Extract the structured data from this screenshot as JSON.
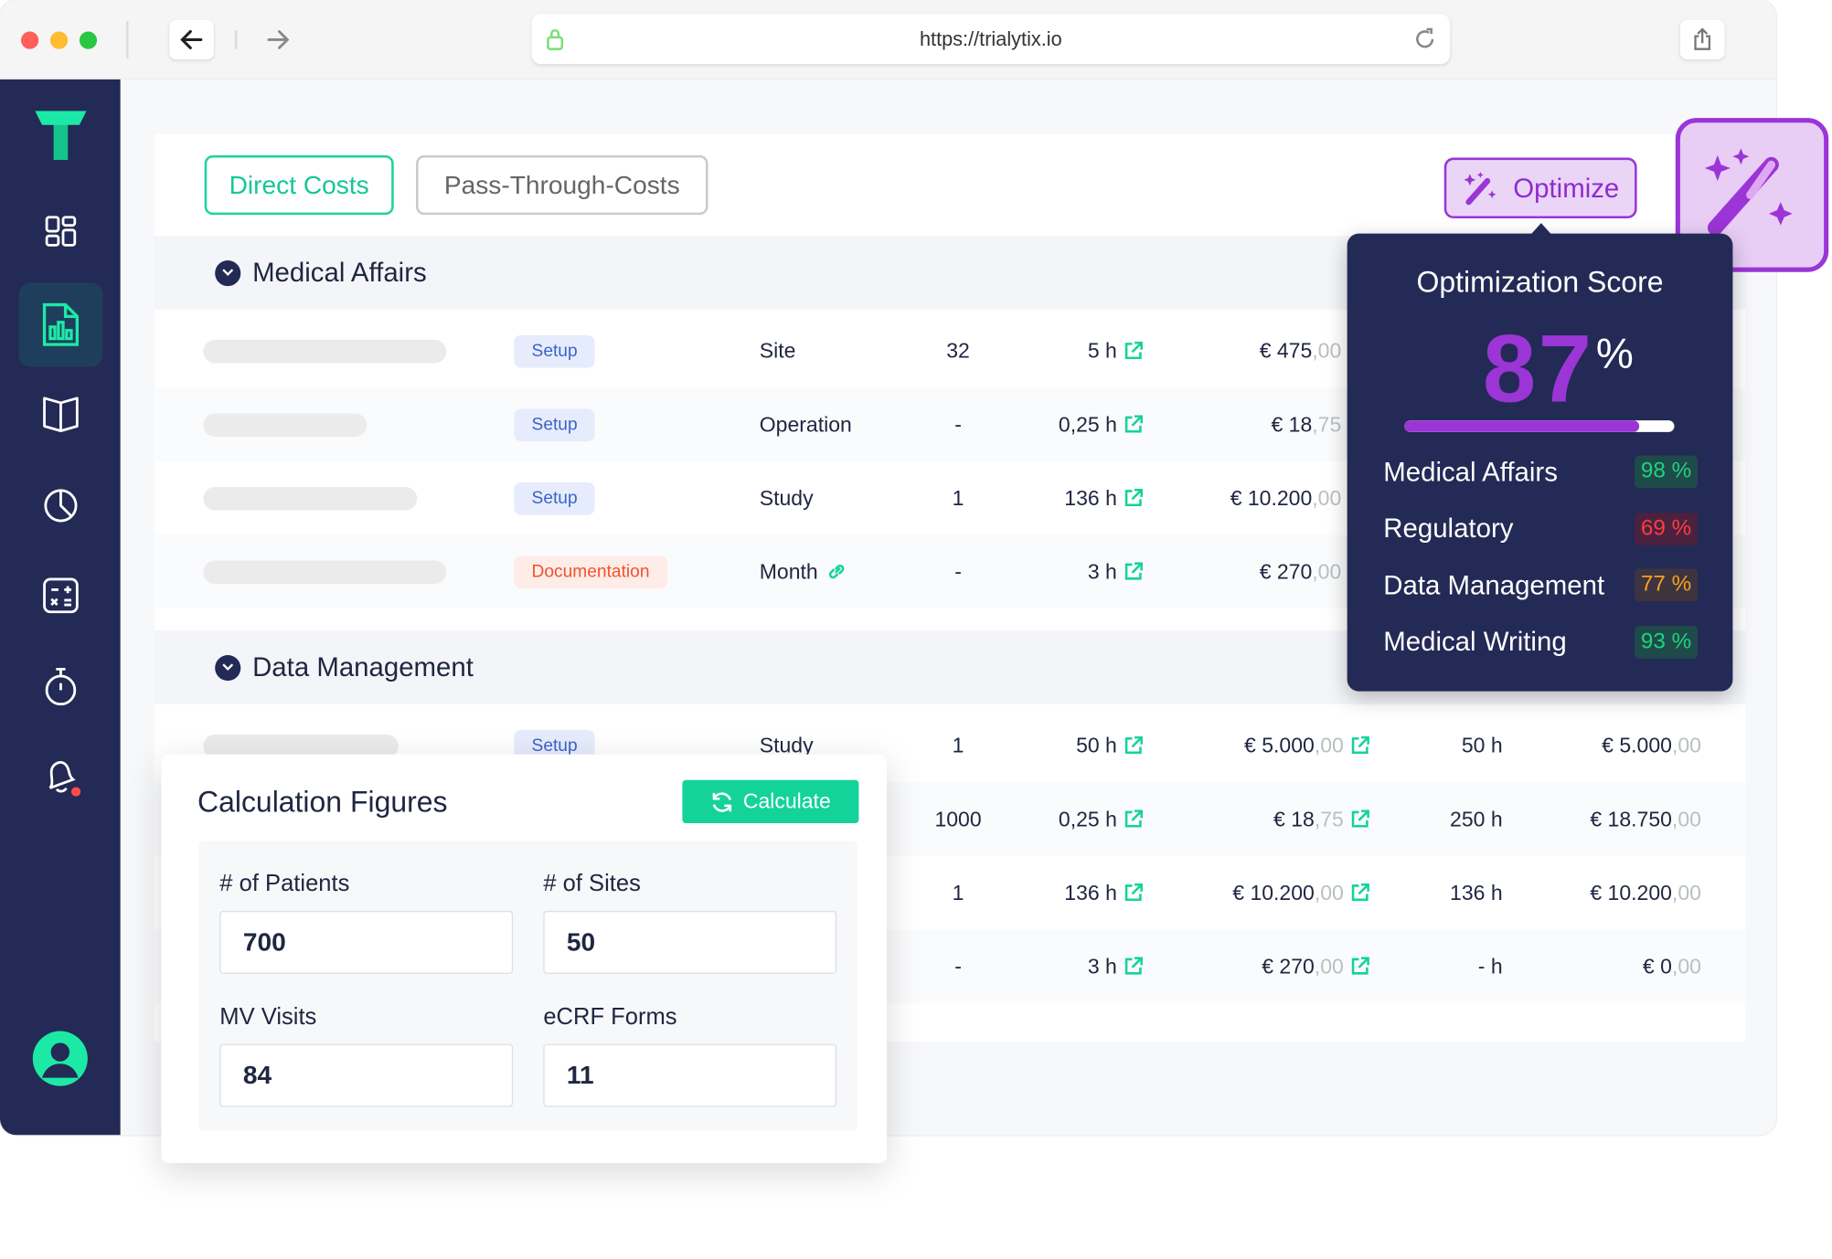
{
  "browser": {
    "url": "https://trialytix.io"
  },
  "colors": {
    "accent": "#13d39a",
    "sidebar": "#232a55",
    "purple": "#9b35d6"
  },
  "sidebar": {
    "items": [
      "dashboard-icon",
      "report-icon",
      "book-icon",
      "pie-chart-icon",
      "calculator-icon",
      "timer-icon",
      "bell-icon"
    ],
    "active": "report-icon"
  },
  "tabs": [
    {
      "label": "Direct Costs",
      "active": true
    },
    {
      "label": "Pass-Through-Costs",
      "active": false
    }
  ],
  "optimize_label": "Optimize",
  "sections": [
    {
      "title": "Medical Affairs",
      "rows": [
        {
          "badge": "Setup",
          "type": "Site",
          "qty": "32",
          "hours": "5 h",
          "cost": "€ 475",
          "cost_dec": ",00"
        },
        {
          "badge": "Setup",
          "type": "Operation",
          "qty": "-",
          "hours": "0,25 h",
          "cost": "€ 18",
          "cost_dec": ",75"
        },
        {
          "badge": "Setup",
          "type": "Study",
          "qty": "1",
          "hours": "136 h",
          "cost": "€ 10.200",
          "cost_dec": ",00"
        },
        {
          "badge": "Documentation",
          "type": "Month",
          "qty": "-",
          "hours": "3 h",
          "cost": "€ 270",
          "cost_dec": ",00"
        }
      ]
    },
    {
      "title": "Data Management",
      "rows": [
        {
          "badge": "Setup",
          "type": "Study",
          "qty": "1",
          "hours": "50 h",
          "cost": "€ 5.000",
          "cost_dec": ",00",
          "hours2": "50 h",
          "total": "€ 5.000",
          "total_dec": ",00"
        },
        {
          "qty": "1000",
          "hours": "0,25 h",
          "cost": "€ 18",
          "cost_dec": ",75",
          "hours2": "250 h",
          "total": "€ 18.750",
          "total_dec": ",00"
        },
        {
          "qty": "1",
          "hours": "136 h",
          "cost": "€ 10.200",
          "cost_dec": ",00",
          "hours2": "136 h",
          "total": "€ 10.200",
          "total_dec": ",00"
        },
        {
          "qty": "-",
          "hours": "3 h",
          "cost": "€ 270",
          "cost_dec": ",00",
          "hours2": "- h",
          "total": "€ 0",
          "total_dec": ",00"
        }
      ]
    }
  ],
  "score": {
    "title": "Optimization Score",
    "value": "87",
    "unit": "%",
    "progress_percent": 87,
    "items": [
      {
        "label": "Medical Affairs",
        "value": "98 %",
        "status": "good"
      },
      {
        "label": "Regulatory",
        "value": "69 %",
        "status": "bad"
      },
      {
        "label": "Data Management",
        "value": "77 %",
        "status": "warn"
      },
      {
        "label": "Medical Writing",
        "value": "93 %",
        "status": "good"
      }
    ]
  },
  "calc": {
    "title": "Calculation Figures",
    "button": "Calculate",
    "fields": [
      {
        "label": "# of Patients",
        "value": "700"
      },
      {
        "label": "# of Sites",
        "value": "50"
      },
      {
        "label": "MV Visits",
        "value": "84"
      },
      {
        "label": "eCRF Forms",
        "value": "11"
      }
    ]
  }
}
